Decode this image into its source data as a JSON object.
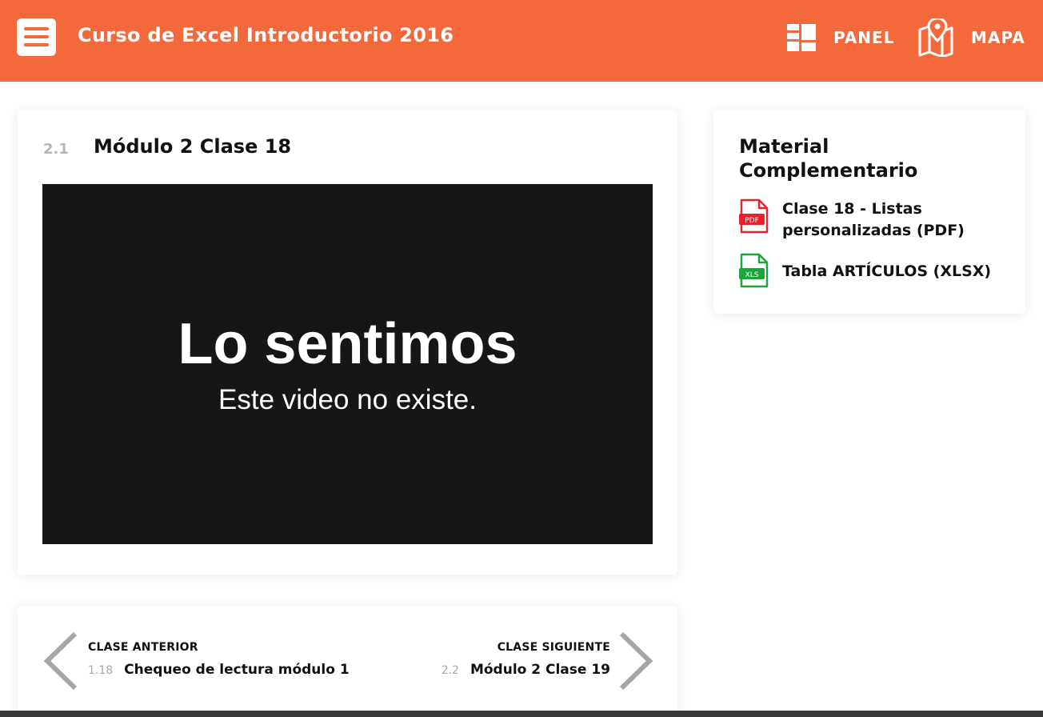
{
  "header": {
    "title": "Curso de Excel Introductorio 2016",
    "panel_label": "PANEL",
    "map_label": "MAPA",
    "accent_color": "#f4693b"
  },
  "lesson": {
    "number": "2.1",
    "title": "Módulo 2 Clase 18"
  },
  "video": {
    "error_title": "Lo sentimos",
    "error_message": "Este video no existe."
  },
  "sidebar": {
    "title": "Material Complementario",
    "resources": [
      {
        "label": "Clase 18 - Listas personalizadas (PDF)",
        "icon": "pdf-file-icon",
        "badge": "PDF",
        "color": "#e8222a"
      },
      {
        "label": "Tabla ARTÍCULOS (XLSX)",
        "icon": "xls-file-icon",
        "badge": "XLS",
        "color": "#1ea33c"
      }
    ]
  },
  "navigation": {
    "previous": {
      "caption": "CLASE ANTERIOR",
      "number": "1.18",
      "title": "Chequeo de lectura módulo 1"
    },
    "next": {
      "caption": "CLASE SIGUIENTE",
      "number": "2.2",
      "title": "Módulo 2 Clase 19"
    }
  }
}
